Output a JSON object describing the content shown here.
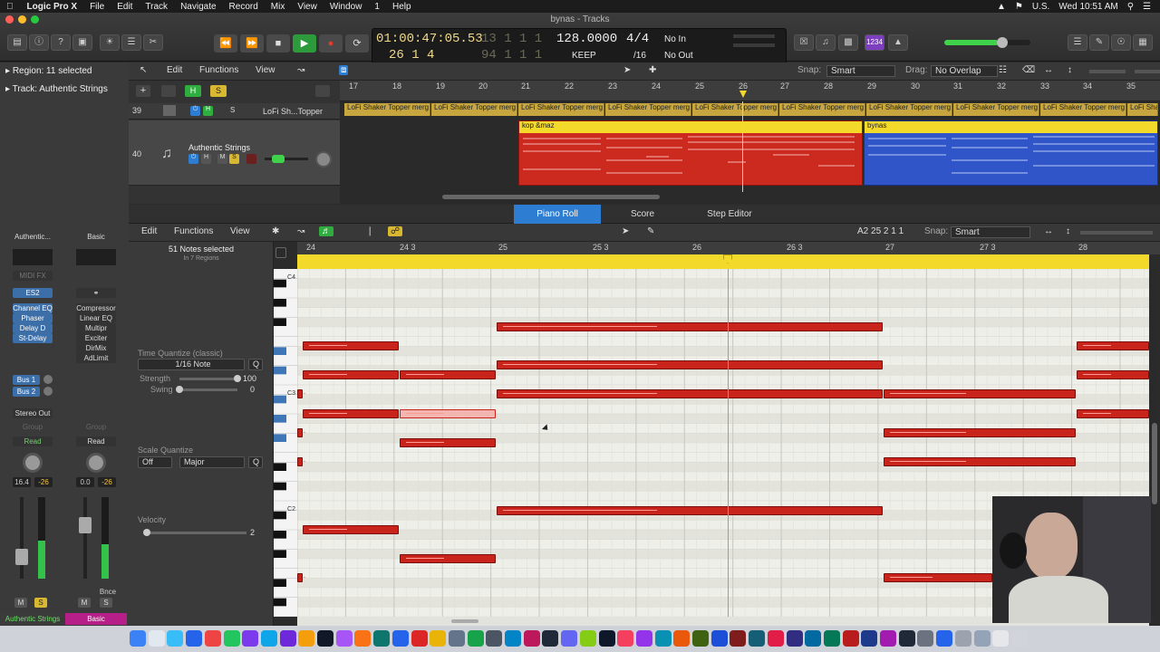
{
  "menubar": {
    "app_name": "Logic Pro X",
    "items": [
      "File",
      "Edit",
      "Track",
      "Navigate",
      "Record",
      "Mix",
      "View",
      "Window",
      "1",
      "Help"
    ],
    "clock": "Wed 10:51 AM",
    "lang": "U.S."
  },
  "window": {
    "title": "bynas - Tracks"
  },
  "lcd": {
    "time": "01:00:47:05.53",
    "bars_dim": "13  1  1    1",
    "position": "26  1  4",
    "pos_dim": "94  1  1    1",
    "tempo": "128.0000",
    "keep": "KEEP",
    "signature": "4/4",
    "division": "/16",
    "in": "No In",
    "out": "No Out"
  },
  "controlbar": {
    "count_in_label": "1234"
  },
  "inspector": {
    "region_label": "Region: 11 selected",
    "track_label": "Track: Authentic Strings"
  },
  "tracks_toolbar": {
    "edit": "Edit",
    "functions": "Functions",
    "view": "View",
    "snap_label": "Snap:",
    "snap_value": "Smart",
    "drag_label": "Drag:",
    "drag_value": "No Overlap"
  },
  "ruler_bars": [
    "17",
    "18",
    "19",
    "20",
    "21",
    "22",
    "23",
    "24",
    "25",
    "26",
    "27",
    "28",
    "29",
    "30",
    "31",
    "32",
    "33",
    "34",
    "35"
  ],
  "tracks": [
    {
      "number": "39",
      "name": "LoFi Sh...Topper",
      "region": "LoFi Shaker Topper merg"
    },
    {
      "number": "40",
      "name": "Authentic Strings",
      "region_a": "kop &maz",
      "region_b": "bynas"
    }
  ],
  "mixer": {
    "strip1": {
      "name": "Authentic...",
      "midi_fx": "MIDI FX",
      "instrument": "ES2",
      "plugins": [
        "Channel EQ",
        "Phaser",
        "Delay D",
        "St-Delay"
      ],
      "sends": [
        "Bus 1",
        "Bus 2"
      ],
      "output": "Stereo Out",
      "group": "Group",
      "automation": "Read",
      "volume": "16.4",
      "pan": "-26",
      "footer": "Authentic Strings"
    },
    "strip2": {
      "name": "Basic",
      "plugins": [
        "Compressor",
        "Linear EQ",
        "Multipr",
        "Exciter",
        "DirMix",
        "AdLimit"
      ],
      "group": "Group",
      "automation": "Read",
      "volume": "0.0",
      "pan": "-26",
      "bounce": "Bnce",
      "footer": "Basic"
    },
    "mute": "M",
    "solo": "S"
  },
  "piano_roll": {
    "tabs": [
      "Piano Roll",
      "Score",
      "Step Editor"
    ],
    "toolbar": {
      "edit": "Edit",
      "functions": "Functions",
      "view": "View",
      "position": "A2  25 2 1 1",
      "snap_label": "Snap:",
      "snap_value": "Smart"
    },
    "selection": "51 Notes selected",
    "regions": "In 7 Regions",
    "time_quantize_label": "Time Quantize (classic)",
    "quantize_value": "1/16 Note",
    "quantize_q": "Q",
    "strength_label": "Strength",
    "strength_value": "100",
    "swing_label": "Swing",
    "swing_value": "0",
    "scale_quantize_label": "Scale Quantize",
    "scale_off": "Off",
    "scale_mode": "Major",
    "velocity_label": "Velocity",
    "velocity_value": "2",
    "ruler": [
      "24",
      "24 3",
      "25",
      "25 3",
      "26",
      "26 3",
      "27",
      "27 3",
      "28"
    ],
    "key_labels": [
      "C4",
      "C3",
      "C2"
    ]
  }
}
